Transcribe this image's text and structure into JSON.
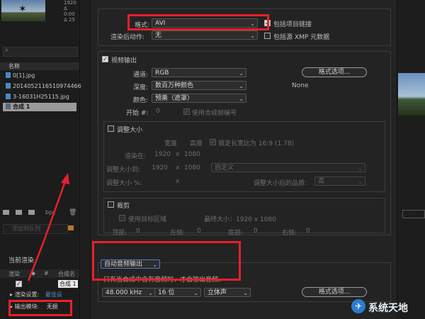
{
  "left_panel": {
    "thumb_meta": [
      "1920",
      "Δ 0:00",
      "Δ 25"
    ],
    "columns": {
      "name": "名称"
    },
    "items": [
      "0[1].jpg",
      "2014052116510974466",
      "3-16031H25115.jpg",
      "合成 1"
    ],
    "footer_label": "bpc",
    "queue_input_placeholder": "添加到队列",
    "render_section": "当前渲染",
    "table_headers": {
      "render": "渲染",
      "num": "#",
      "comp": "合成名"
    },
    "row_comp": "合成 1",
    "render_settings_label": "渲染设置:",
    "render_settings_value": "最佳设",
    "output_module_label": "输出模块:",
    "output_module_value": "无损"
  },
  "format_section": {
    "format_label": "格式:",
    "format_value": "AVI",
    "include_project_link": "包括项目链接",
    "post_render_label": "渲染后动作:",
    "post_render_value": "无",
    "include_xmp": "包括源 XMP 元数据"
  },
  "video_output": {
    "title": "视频输出",
    "channels_label": "通道:",
    "channels_value": "RGB",
    "depth_label": "深度:",
    "depth_value": "数百万种颜色",
    "color_label": "颜色:",
    "color_value": "预乘（遮罩）",
    "start_label": "开始 #:",
    "start_value": "0",
    "use_comp_frame": "使用合成帧编号",
    "format_options": "格式选项...",
    "codec_value": "None"
  },
  "resize": {
    "title": "调整大小",
    "width": "宽度",
    "height": "高度",
    "lock_aspect": "锁定长宽比为 16:9 (1.78)",
    "render_at_label": "渲染在:",
    "render_at_w": "1920",
    "render_at_h": "1080",
    "x": "x",
    "resize_to_label": "调整大小到:",
    "resize_to_w": "1920",
    "resize_to_h": "1080",
    "custom": "自定义",
    "resize_pct_label": "调整大小 %:",
    "quality_label": "调整大小后的品质:",
    "quality_value": "高"
  },
  "crop": {
    "title": "裁剪",
    "use_roi": "使用目标区域",
    "final_size": "最终大小：1920 x 1080",
    "top": "顶部:",
    "left": "左侧:",
    "bottom": "底部:",
    "right": "右侧:",
    "zero": "0"
  },
  "audio": {
    "auto_output": "自动音频输出",
    "note": "只有当合成中含有音频时，才会输出音频。",
    "rate": "48.000 kHz",
    "bits": "16 位",
    "channels": "立体声",
    "format_options": "格式选项..."
  },
  "watermark": "系统天地",
  "colors": {
    "red_highlight": "#e8202a",
    "annotation_arrow": "#e8202a",
    "dialog_bg": "#232323"
  }
}
